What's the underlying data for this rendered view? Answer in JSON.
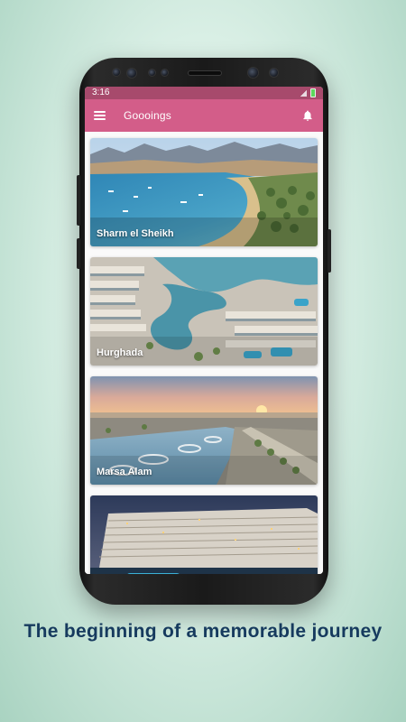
{
  "status_bar": {
    "time": "3:16"
  },
  "app_bar": {
    "title": "Goooings",
    "menu_icon": "menu-icon",
    "notification_icon": "bell-icon"
  },
  "destinations": [
    {
      "name": "Sharm el Sheikh"
    },
    {
      "name": "Hurghada"
    },
    {
      "name": "Marsa Alam"
    },
    {
      "name": ""
    }
  ],
  "tagline": "The beginning of a memorable journey",
  "colors": {
    "status_bar": "#a74a6c",
    "app_bar": "#d35d89",
    "tagline": "#163a5e"
  }
}
